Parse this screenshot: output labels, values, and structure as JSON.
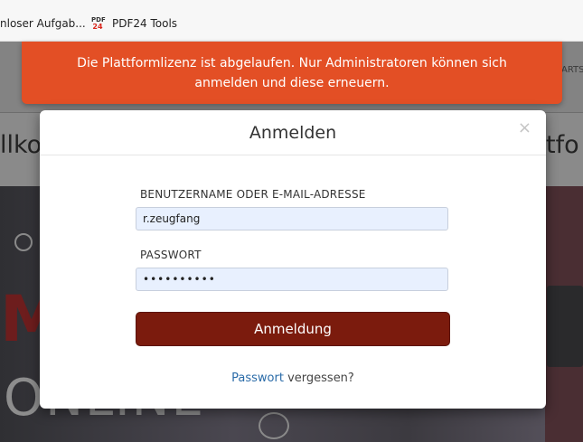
{
  "bookmarks": {
    "item1": "nloser Aufgab...",
    "item2_icon": "pdf24-icon",
    "item2_icon_top": "PDF",
    "item2_icon_bottom": "24",
    "item2": "PDF24 Tools"
  },
  "background": {
    "nav_fragment": "ARTS",
    "heading_left": "llko",
    "heading_right": "tfo",
    "hero_letter": "M",
    "hero_text": "ONLINE"
  },
  "alert": {
    "text": "Die Plattformlizenz ist abgelaufen. Nur Administratoren können sich anmelden und diese erneuern."
  },
  "modal": {
    "title": "Anmelden",
    "close": "×",
    "username_label": "BENUTZERNAME ODER E-MAIL-ADRESSE",
    "username_value": "r.zeugfang",
    "password_label": "PASSWORT",
    "password_value": "••••••••••",
    "submit_label": "Anmeldung",
    "forgot_link": "Passwort",
    "forgot_rest": " vergessen?"
  },
  "colors": {
    "alert": "#e34f25",
    "button": "#7b1b0d",
    "link": "#2a6ba8",
    "input_bg": "#e8f0fe"
  }
}
